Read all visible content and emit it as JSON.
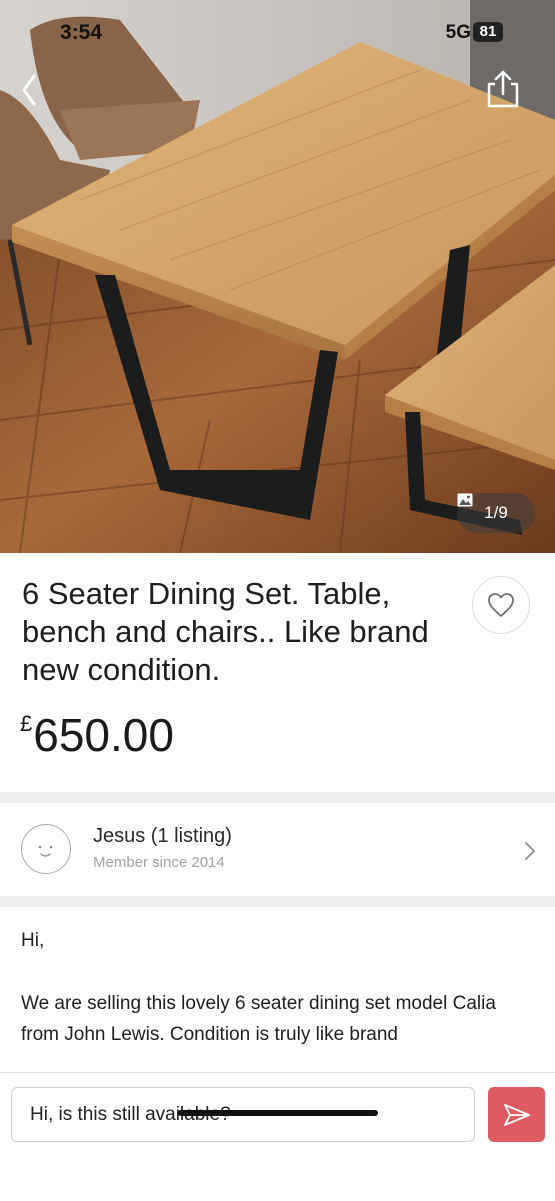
{
  "status_bar": {
    "time": "3:54",
    "network": "5G",
    "battery": "81"
  },
  "gallery": {
    "counter": "1/9"
  },
  "listing": {
    "title": "6 Seater Dining Set. Table, bench and chairs.. Like brand new condition.",
    "currency": "£",
    "price": "650.00"
  },
  "seller": {
    "name": "Jesus (1 listing)",
    "member_since": "Member since 2014"
  },
  "description": {
    "greeting": "Hi,",
    "body": "We are selling this lovely 6 seater dining set model Calia from John Lewis. Condition is truly like brand"
  },
  "message": {
    "value": "Hi, is this still available?"
  },
  "colors": {
    "send_button": "#e05a62",
    "divider": "#efefef"
  },
  "icons": [
    "back-chevron-icon",
    "share-icon",
    "image-icon",
    "heart-icon",
    "chevron-right-icon",
    "send-icon"
  ]
}
